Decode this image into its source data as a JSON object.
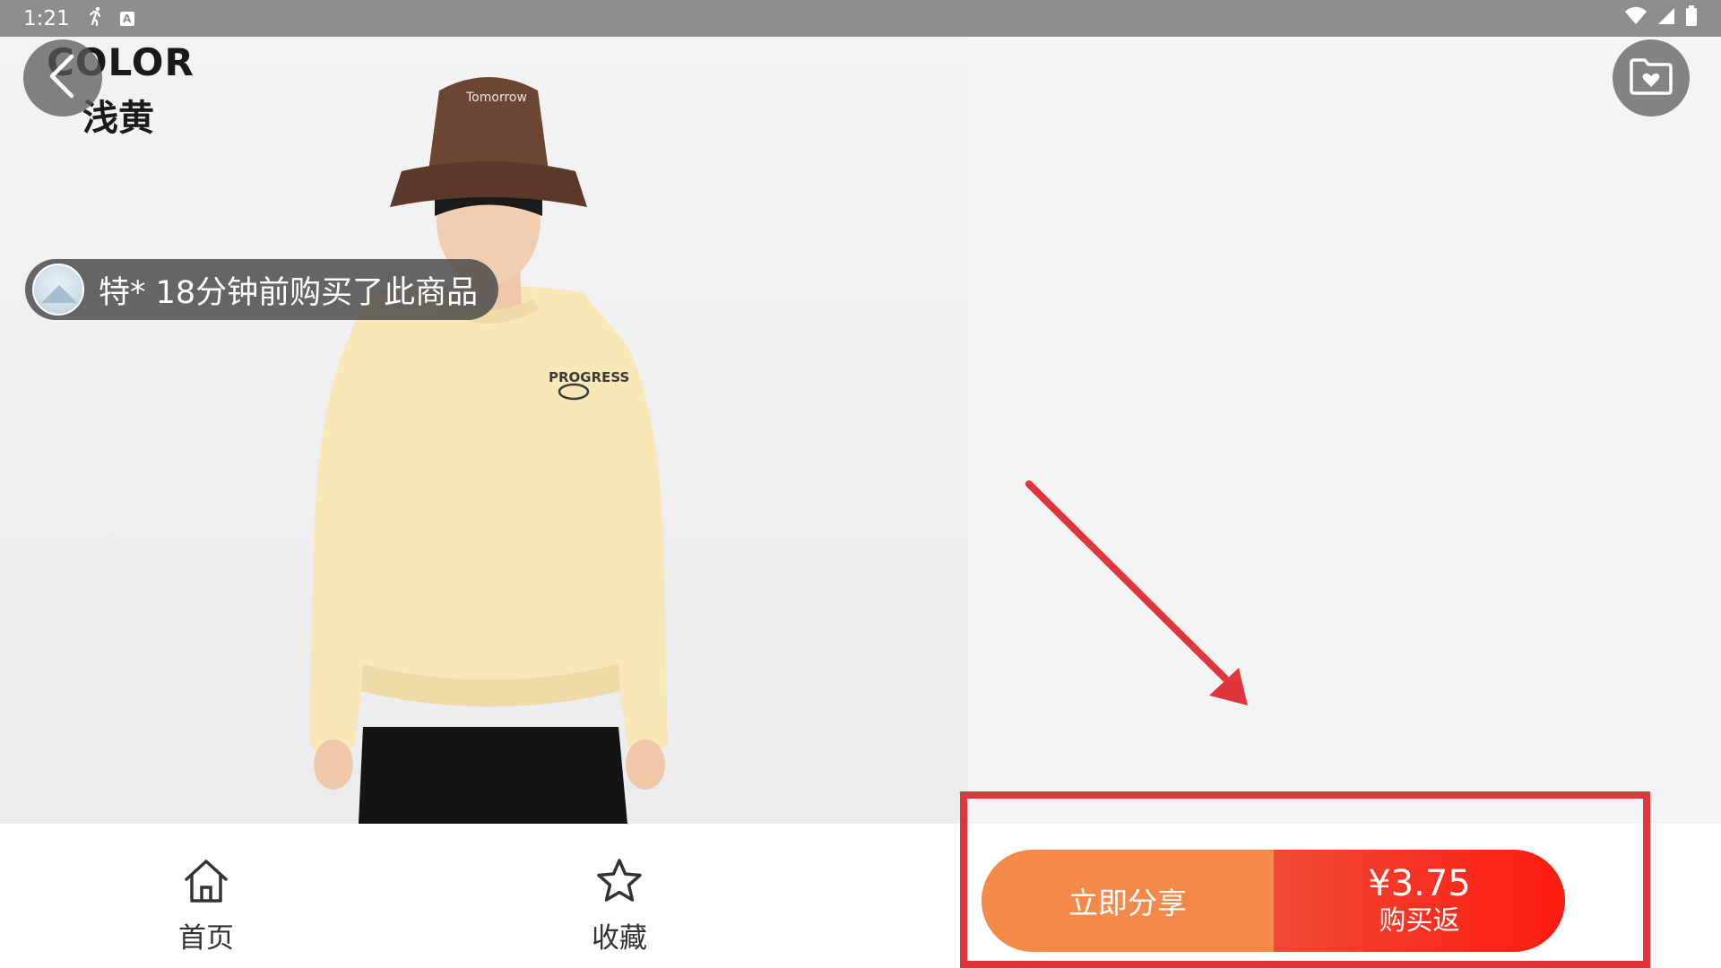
{
  "status_bar": {
    "time": "1:21",
    "icons": [
      "running-icon",
      "a-box-icon",
      "wifi-icon",
      "signal-icon",
      "battery-icon"
    ]
  },
  "product": {
    "color_label": "COLOR",
    "color_value": "浅黄",
    "image_desc_icon": "product-photo",
    "sweatshirt_text": "PROGRESS"
  },
  "header": {
    "back_icon": "chevron-left-icon",
    "favorite_folder_icon": "folder-heart-icon"
  },
  "buyer_notice": {
    "text": "特* 18分钟前购买了此商品"
  },
  "bottom_nav": {
    "home_label": "首页",
    "home_icon": "home-icon",
    "favorite_label": "收藏",
    "favorite_icon": "star-icon"
  },
  "actions": {
    "share_label": "立即分享",
    "buy_price": "¥3.75",
    "buy_sub_label": "购买返"
  },
  "colors": {
    "share_orange": "#f5894a",
    "buy_red": "#ff1b10",
    "annotation_red": "#e0363b"
  }
}
